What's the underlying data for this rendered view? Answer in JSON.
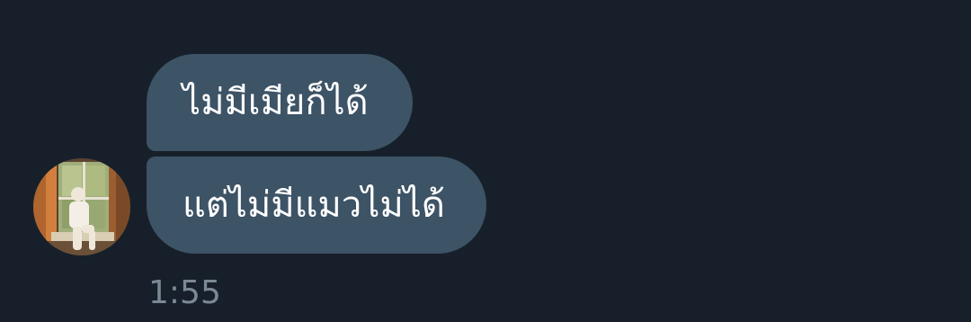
{
  "messages": [
    {
      "text": "ไม่มีเมียก็ได้"
    },
    {
      "text": "แต่ไม่มีแมวไม่ได้"
    }
  ],
  "timestamp": "1:55",
  "colors": {
    "background": "#17202a",
    "bubble": "#3d5366",
    "message_text": "#ffffff",
    "timestamp_text": "#7b8896"
  }
}
